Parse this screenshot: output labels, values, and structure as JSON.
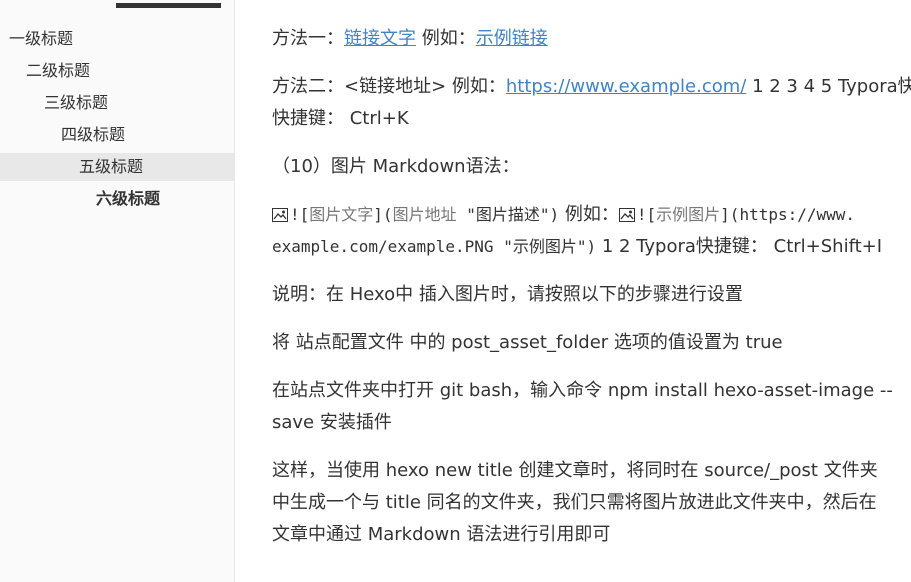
{
  "toc": {
    "items": [
      {
        "label": "一级标题"
      },
      {
        "label": "二级标题"
      },
      {
        "label": "三级标题"
      },
      {
        "label": "四级标题"
      },
      {
        "label": "五级标题"
      },
      {
        "label": "六级标题"
      }
    ]
  },
  "content": {
    "p1": {
      "prefix": "方法一：",
      "link_text": "链接文字",
      "mid": " 例如：",
      "example_link": "示例链接"
    },
    "p2": {
      "prefix": "方法二：<链接地址> 例如：",
      "url": "https://www.example.com/",
      "suffix": " 1 2 3 4 5 Typora快捷键：Ctrl+K",
      "line2": "快捷键： Ctrl+K"
    },
    "p3": {
      "heading": "（10）图片 Markdown语法："
    },
    "p4": {
      "bang1": "!",
      "b1o": "[",
      "alt": "图片文字",
      "b1c": "](",
      "addr": "图片地址",
      "sp": " ",
      "desc": "\"图片描述\"",
      "p1c": ")",
      "mid": " 例如：",
      "bang2": "!",
      "b2o": "[",
      "ex_alt": "示例图片",
      "b2c": "](",
      "ex_url_start": "https://www.",
      "line2_url": "example.com/example.PNG",
      "line2_sp": " ",
      "line2_desc": "\"示例图片\"",
      "line2_close": ")",
      "line2_suffix": " 1 2 Typora快捷键： Ctrl+Shift+I"
    },
    "p5": "说明：在 Hexo中 插入图片时，请按照以下的步骤进行设置",
    "p6": "将 站点配置文件 中的 post_asset_folder 选项的值设置为 true",
    "p7": {
      "line1": "在站点文件夹中打开 git bash，输入命令 npm install hexo-asset-image --",
      "line2": "save 安装插件"
    },
    "p8": {
      "line1": "这样，当使用 hexo new title 创建文章时，将同时在 source/_post 文件夹",
      "line2": "中生成一个与 title 同名的文件夹，我们只需将图片放进此文件夹中，然后在",
      "line3": "文章中通过 Markdown 语法进行引用即可"
    }
  }
}
